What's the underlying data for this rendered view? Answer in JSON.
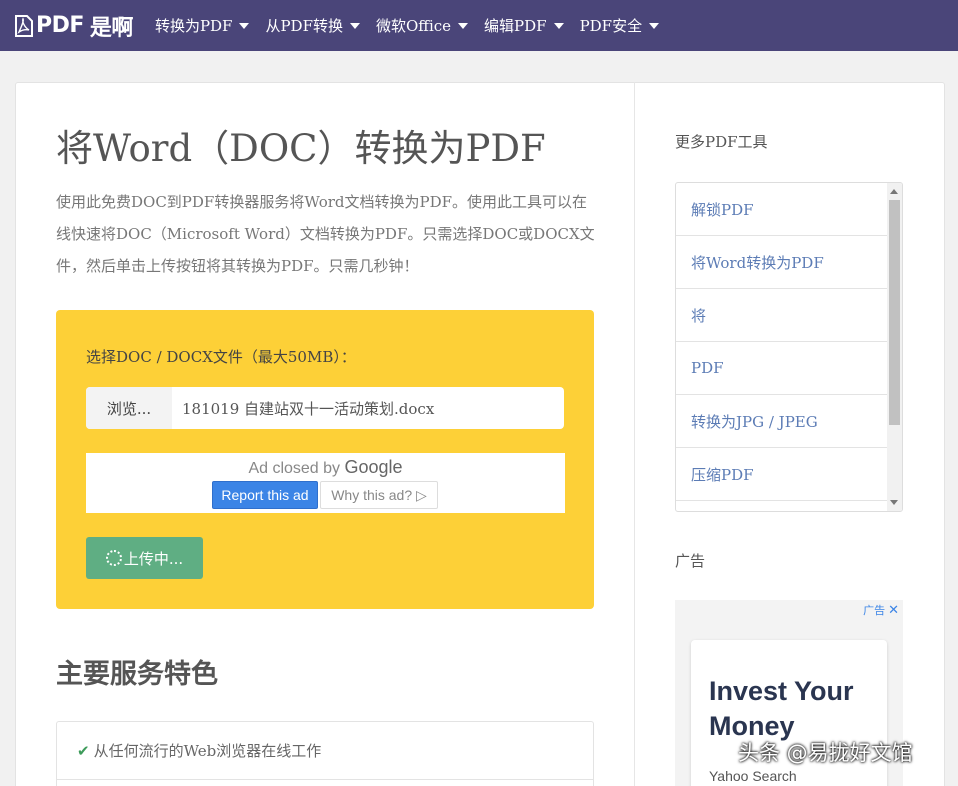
{
  "navbar": {
    "brand": "PDF",
    "brand_suffix": "是啊",
    "items": [
      {
        "label": "转换为PDF"
      },
      {
        "label": "从PDF转换"
      },
      {
        "label": "微软Office"
      },
      {
        "label": "编辑PDF"
      },
      {
        "label": "PDF安全"
      }
    ],
    "bg_color": "#4a4579"
  },
  "main": {
    "title": "将Word（DOC）转换为PDF",
    "description": "使用此免费DOC到PDF转换器服务将Word文档转换为PDF。使用此工具可以在线快速将DOC（Microsoft Word）文档转换为PDF。只需选择DOC或DOCX文件，然后单击上传按钮将其转换为PDF。只需几秒钟！",
    "upload": {
      "label": "选择DOC / DOCX文件（最大50MB）：",
      "browse_label": "浏览...",
      "file_name": "181019  自建站双十一活动策划.docx",
      "upload_button": "上传中...",
      "box_color": "#fdd037",
      "button_color": "#5fae83"
    },
    "ad_notice": {
      "closed_text": "Ad closed by",
      "closed_brand": "Google",
      "report_label": "Report this ad",
      "why_label": "Why this ad? ▷"
    },
    "features_title": "主要服务特色",
    "features": [
      {
        "label": "从任何流行的Web浏览器在线工作"
      }
    ]
  },
  "sidebar": {
    "tools_title": "更多PDF工具",
    "tools": [
      {
        "label": "解锁PDF"
      },
      {
        "label": "将Word转换为PDF"
      },
      {
        "label": "将"
      },
      {
        "label": "PDF"
      },
      {
        "label": "转换为JPG / JPEG"
      },
      {
        "label": "压缩PDF"
      }
    ],
    "ad_title": "广告",
    "ad": {
      "badge": "广告",
      "headline": "Invest Your Money",
      "source": "Yahoo Search"
    }
  },
  "watermark": "头条 @易拢好文馆"
}
